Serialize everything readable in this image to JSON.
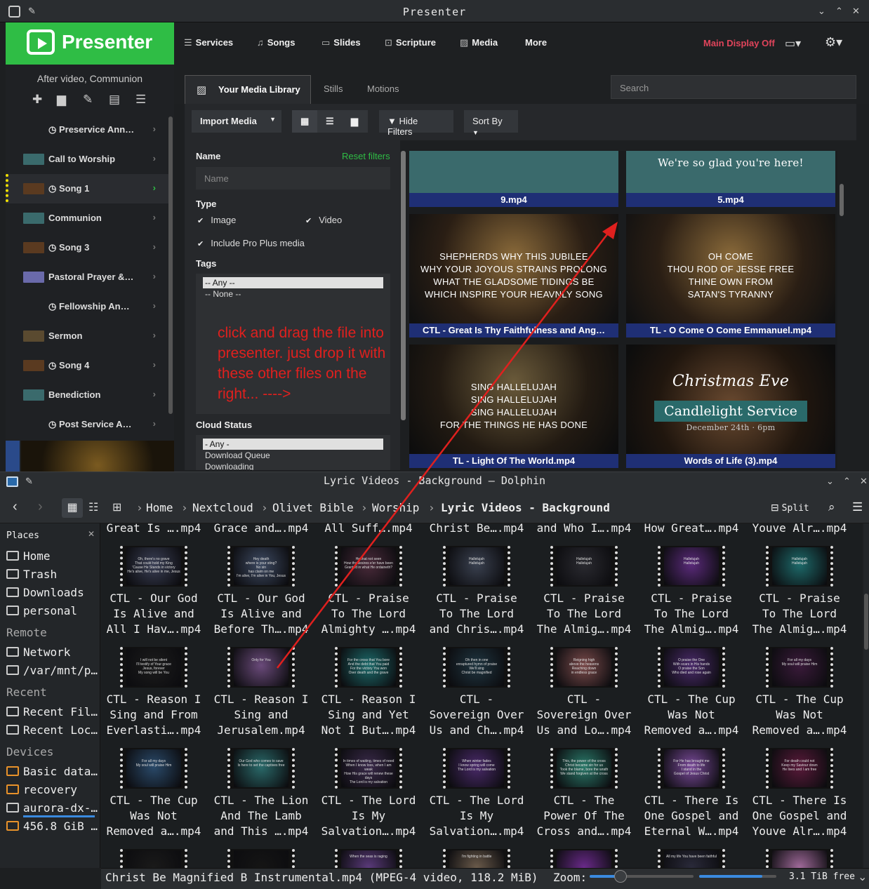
{
  "presenter": {
    "window_title": "Presenter",
    "brand": "Presenter",
    "nav": {
      "services": "Services",
      "songs": "Songs",
      "slides": "Slides",
      "scripture": "Scripture",
      "media": "Media",
      "more": "More"
    },
    "main_display": "Main Display Off",
    "service_name": "After video, Communion",
    "service_items": [
      {
        "label": "Preservice Ann…",
        "clock": true,
        "thumb": false
      },
      {
        "label": "Call to Worship",
        "clock": false,
        "thumb": true
      },
      {
        "label": "Song 1",
        "clock": true,
        "thumb": true,
        "active": true
      },
      {
        "label": "Communion",
        "clock": false,
        "thumb": true
      },
      {
        "label": "Song 3",
        "clock": true,
        "thumb": true
      },
      {
        "label": "Pastoral Prayer &…",
        "clock": false,
        "thumb": true
      },
      {
        "label": "Fellowship An…",
        "clock": true,
        "thumb": false
      },
      {
        "label": "Sermon",
        "clock": false,
        "thumb": true
      },
      {
        "label": "Song 4",
        "clock": true,
        "thumb": true
      },
      {
        "label": "Benediction",
        "clock": false,
        "thumb": true
      },
      {
        "label": "Post Service A…",
        "clock": true,
        "thumb": false
      }
    ],
    "media_tabs": {
      "library": "Your Media Library",
      "stills": "Stills",
      "motions": "Motions"
    },
    "search_placeholder": "Search",
    "toolbar": {
      "import": "Import Media",
      "hide_filters": "Hide Filters",
      "sort_by": "Sort By"
    },
    "filters": {
      "name_label": "Name",
      "reset": "Reset filters",
      "name_placeholder": "Name",
      "type_label": "Type",
      "image": "Image",
      "video": "Video",
      "pro_plus": "Include Pro Plus media",
      "tags_label": "Tags",
      "tags": [
        "-- Any --",
        "-- None --"
      ],
      "cloud_label": "Cloud Status",
      "cloud": [
        "- Any -",
        "Download Queue",
        "Downloading"
      ]
    },
    "annotation": "click and drag the file into presenter. just drop it with these other files on the right... ---->",
    "media_tiles": [
      {
        "caption": "9.mp4",
        "text": ""
      },
      {
        "caption": "5.mp4",
        "text": "We're so glad you're here!"
      },
      {
        "caption": "CTL - Great Is Thy Faithfulness and Ang…",
        "text": "SHEPHERDS WHY THIS JUBILEE\nWHY YOUR JOYOUS STRAINS PROLONG\nWHAT THE GLADSOME TIDINGS BE\nWHICH INSPIRE YOUR HEAVNLY SONG"
      },
      {
        "caption": "TL - O Come O Come Emmanuel.mp4",
        "text": "OH COME\nTHOU ROD OF JESSE FREE\nTHINE OWN FROM\nSATAN'S TYRANNY"
      },
      {
        "caption": "TL - Light Of The World.mp4",
        "text": "SING HALLELUJAH\nSING HALLELUJAH\nSING HALLELUJAH\nFOR THE THINGS HE HAS DONE"
      },
      {
        "caption": "Words of Life (3).mp4",
        "text": "Christmas Eve",
        "text2": "Candlelight Service",
        "text3": "December 24th · 6pm"
      }
    ]
  },
  "dolphin": {
    "window_title": "Lyric Videos - Background — Dolphin",
    "breadcrumb": [
      "Home",
      "Nextcloud",
      "Olivet Bible",
      "Worship",
      "Lyric Videos - Background"
    ],
    "split": "Split",
    "places_title": "Places",
    "sections": {
      "remote": "Remote",
      "recent": "Recent",
      "devices": "Devices"
    },
    "places": [
      "Home",
      "Trash",
      "Downloads",
      "personal"
    ],
    "remote": [
      "Network",
      "/var/mnt/p…"
    ],
    "recent": [
      "Recent Fil…",
      "Recent Loc…"
    ],
    "devices": [
      "Basic data…",
      "recovery",
      "aurora-dx-…",
      "456.8 GiB …"
    ],
    "top_row": [
      "Great Is ….mp4",
      "Grace and….mp4",
      "All Suff….mp4",
      "Christ Be….mp4",
      "and Who I….mp4",
      "How Great….mp4",
      "Youve Alr….mp4"
    ],
    "rows": [
      [
        {
          "name": "CTL - Our God\nIs Alive and\nAll I Hav….mp4",
          "lyric": "Oh, there's no grave\nThat could hold my King\n'Cause He Stands in victory\nHe's alive, He's alive in me, Jesus",
          "color": "#3a3f55"
        },
        {
          "name": "CTL - Our God\nIs Alive and\nBefore Th….mp4",
          "lyric": "Hey death\nwhere is your sting?\nNo sin\nhas claim on me\nI'm alive, I'm alive in You, Jesus",
          "color": "#3d4a62"
        },
        {
          "name": "CTL - Praise\nTo The Lord\nAlmighty ….mp4",
          "lyric": "He that not seen\nHow thy desires e'er have been\nGranted in what He ordaineth?",
          "color": "#4a2a3a"
        },
        {
          "name": "CTL - Praise\nTo The Lord\nand Chris….mp4",
          "lyric": "Hallelujah\nHallelujah",
          "color": "#3a4150"
        },
        {
          "name": "CTL - Praise\nTo The Lord\nThe Almig….mp4",
          "lyric": "Hallelujah\nHallelujah",
          "color": "#2a2a30"
        },
        {
          "name": "CTL - Praise\nTo The Lord\nThe Almig….mp4",
          "lyric": "Hallelujah\nHallelujah",
          "color": "#5a2a7a"
        },
        {
          "name": "CTL - Praise\nTo The Lord\nThe Almig….mp4",
          "lyric": "Hallelujah\nHallelujah",
          "color": "#1d6a6a"
        }
      ],
      [
        {
          "name": "CTL - Reason I\nSing and From\nEverlasti….mp4",
          "lyric": "I will not be silent\nI'll testify of Your grace\nJesus, forever\nMy song will be You",
          "color": "#1c1c1c"
        },
        {
          "name": "CTL - Reason I\nSing and\nJerusalem.mp4",
          "lyric": "Only for You",
          "color": "#6a4a7a"
        },
        {
          "name": "CTL - Reason I\nSing and Yet\nNot I But….mp4",
          "lyric": "For the cross that You bore\nAnd the debt that You paid\nFor the victory You won\nOver death and the grave",
          "color": "#1c6a6a"
        },
        {
          "name": "CTL -\nSovereign Over\nUs and Ch….mp4",
          "lyric": "Oh then in one\nenraptured hymn of praise\nWe'll sing\nChrist be magnified",
          "color": "#1f3540"
        },
        {
          "name": "CTL -\nSovereign Over\nUs and Lo….mp4",
          "lyric": "Reigning high\nabove the heavens\nReaching down\nin endless grace",
          "color": "#7a4a4a"
        },
        {
          "name": "CTL - The Cup\nWas Not\nRemoved a….mp4",
          "lyric": "O praise the One\nWith scars in His hands\nO praise the Son\nWho died and rose again",
          "color": "#4a2a6a"
        },
        {
          "name": "CTL - The Cup\nWas Not\nRemoved a….mp4",
          "lyric": "For all my days\nMy soul will praise Him",
          "color": "#3a1a3a"
        }
      ],
      [
        {
          "name": "CTL - The Cup\nWas Not\nRemoved a….mp4",
          "lyric": "For all my days\nMy soul will praise Him",
          "color": "#2a4a6a"
        },
        {
          "name": "CTL - The Lion\nAnd The Lamb\nand This ….mp4",
          "lyric": "Our God who comes to save\nIs here to set the captives free",
          "color": "#2a6a6a"
        },
        {
          "name": "CTL - The Lord\nIs My\nSalvation….mp4",
          "lyric": "In times of waiting, times of need\nWhen I know loss, when I am weak\nHow His grace will renew these days\nThe Lord is my salvation",
          "color": "#3a2a4a"
        },
        {
          "name": "CTL - The Lord\nIs My\nSalvation….mp4",
          "lyric": "When winter fades\nI know spring will come\nThe Lord is my salvation",
          "color": "#4a2a6a"
        },
        {
          "name": "CTL - The\nPower Of The\nCross and….mp4",
          "lyric": "This, the power of the cross\nChrist became sin for us\nTook the blame, bore the wrath\nWe stand forgiven at the cross",
          "color": "#2a7a6a"
        },
        {
          "name": "CTL - There Is\nOne Gospel and\nEternal W….mp4",
          "lyric": "For He has brought me\nFrom death to life\nI stand in the\nGospel of Jesus Christ",
          "color": "#7a4a9a"
        },
        {
          "name": "CTL - There Is\nOne Gospel and\nYouve Alr….mp4",
          "lyric": "For death could not\nKeep my Saviour down\nHe lives and I am free",
          "color": "#5a1a3a"
        }
      ]
    ],
    "bottom_row": [
      {
        "lyric": "",
        "color": "#1a1a1a"
      },
      {
        "lyric": "",
        "color": "#151515"
      },
      {
        "lyric": "When the seas is raging",
        "color": "#5a3a7a"
      },
      {
        "lyric": "I'm fighting in battle",
        "color": "#6a5a4a"
      },
      {
        "lyric": "",
        "color": "#6a2a8a"
      },
      {
        "lyric": "All my life You have been faithful",
        "color": "#2a2a3a"
      },
      {
        "lyric": "",
        "color": "#a06a9a"
      }
    ],
    "status": "Christ Be Magnified B Instrumental.mp4 (MPEG-4 video, 118.2 MiB)",
    "zoom_label": "Zoom:",
    "zoom_level": 0.3,
    "free_fill": 0.82,
    "free": "3.1 TiB free"
  },
  "colors": {
    "brand": "#2fbd45",
    "annotation": "#e0201e",
    "caption_bar": "#1f2f75",
    "main_display": "#e0445b"
  }
}
